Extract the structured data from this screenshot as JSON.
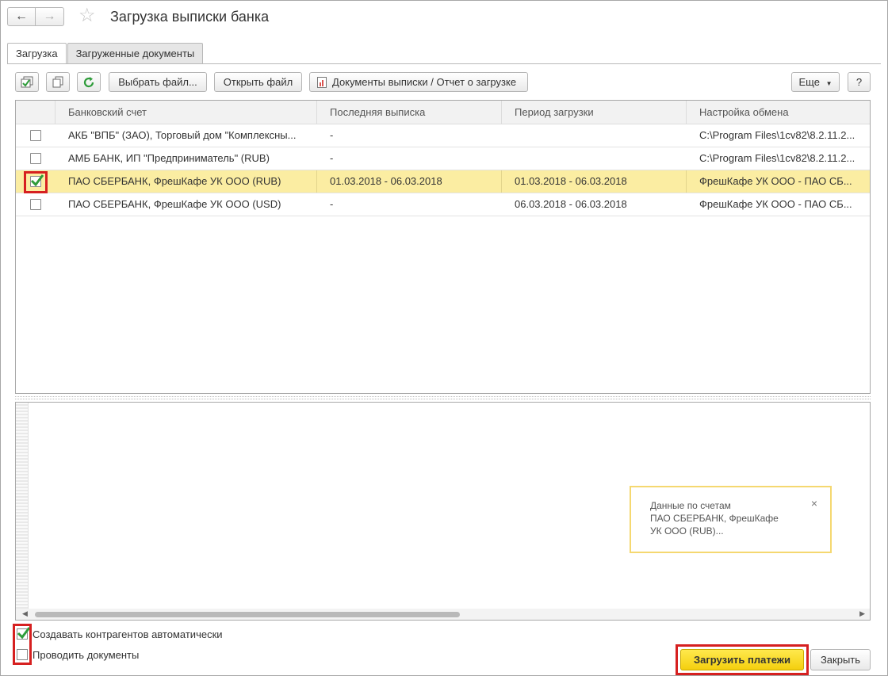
{
  "window": {
    "title": "Загрузка выписки банка"
  },
  "tabs": [
    {
      "label": "Загрузка",
      "active": true
    },
    {
      "label": "Загруженные документы",
      "active": false
    }
  ],
  "toolbar": {
    "select_file": "Выбрать файл...",
    "open_file": "Открыть файл",
    "docs_report": "Документы выписки / Отчет о загрузке",
    "more": "Еще",
    "help": "?"
  },
  "table": {
    "columns": [
      "Банковский счет",
      "Последняя выписка",
      "Период загрузки",
      "Настройка обмена"
    ],
    "rows": [
      {
        "checked": false,
        "account": "АКБ \"ВПБ\" (ЗАО), Торговый дом \"Комплексны...",
        "last": "-",
        "period": "",
        "settings": "C:\\Program Files\\1cv82\\8.2.11.2...",
        "selected": false
      },
      {
        "checked": false,
        "account": "АМБ БАНК, ИП \"Предприниматель\" (RUB)",
        "last": "-",
        "period": "",
        "settings": "C:\\Program Files\\1cv82\\8.2.11.2...",
        "selected": false
      },
      {
        "checked": true,
        "account": "ПАО СБЕРБАНК, ФрешКафе УК ООО (RUB)",
        "last": "01.03.2018 - 06.03.2018",
        "period": "01.03.2018 - 06.03.2018",
        "settings": "ФрешКафе УК ООО - ПАО СБ...",
        "selected": true
      },
      {
        "checked": false,
        "account": "ПАО СБЕРБАНК, ФрешКафе УК ООО (USD)",
        "last": "-",
        "period": "06.03.2018 - 06.03.2018",
        "settings": "ФрешКафе УК ООО - ПАО СБ...",
        "selected": false
      }
    ]
  },
  "notification": {
    "text": "Данные по счетам\nПАО СБЕРБАНК, ФрешКафе\nУК ООО (RUB)...",
    "close": "×"
  },
  "options": {
    "create_counterparties": {
      "label": "Создавать контрагентов автоматически",
      "checked": true
    },
    "post_documents": {
      "label": "Проводить документы",
      "checked": false
    }
  },
  "buttons": {
    "load_payments": "Загрузить платежи",
    "close": "Закрыть"
  },
  "colors": {
    "selected_row": "#fbeda2",
    "primary_button": "#f4cf0e",
    "highlight_box": "#d62020",
    "check": "#2e9c3a"
  }
}
